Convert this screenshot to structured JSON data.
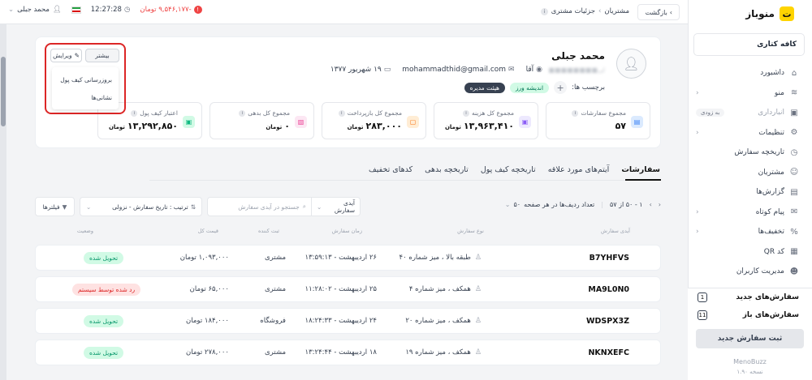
{
  "brand": {
    "name": "منوباز",
    "logo_glyph": "ت"
  },
  "sidebar": {
    "cafe": "کافه کتاری",
    "items": [
      {
        "label": "داشبورد",
        "icon": "dashboard-icon",
        "glyph": "⌂"
      },
      {
        "label": "منو",
        "icon": "layers-icon",
        "glyph": "≋",
        "chevron": true
      },
      {
        "label": "انبارداری",
        "icon": "warehouse-icon",
        "glyph": "▣",
        "soon": "به زودی",
        "muted": true
      },
      {
        "label": "تنظیمات",
        "icon": "gear-icon",
        "glyph": "⚙",
        "chevron": true
      },
      {
        "label": "تاریخچه سفارش",
        "icon": "history-icon",
        "glyph": "◷"
      },
      {
        "label": "مشتریان",
        "icon": "users-icon",
        "glyph": "☺"
      },
      {
        "label": "گزارش‌ها",
        "icon": "report-icon",
        "glyph": "▤"
      },
      {
        "label": "پیام کوتاه",
        "icon": "sms-icon",
        "glyph": "✉",
        "chevron": true
      },
      {
        "label": "تخفیف‌ها",
        "icon": "discount-icon",
        "glyph": "%",
        "chevron": true
      },
      {
        "label": "کد QR",
        "icon": "qr-icon",
        "glyph": "▦"
      },
      {
        "label": "مدیریت کاربران",
        "icon": "user-manage-icon",
        "glyph": "☻"
      }
    ],
    "counters": [
      {
        "label": "سفارش‌های جدید",
        "count": "1"
      },
      {
        "label": "سفارش‌های باز",
        "count": "11"
      }
    ],
    "new_order_button": "ثبت سفارش جدید",
    "footer_brand": "MenoBuzz",
    "footer_version": "نسخه ۱.۹۰"
  },
  "topbar": {
    "back": "بازگشت",
    "back_icon": "›",
    "crumb_parent": "مشتریان",
    "crumb_current": "جزئیات مشتری",
    "time": "12:27:28",
    "user": "محمد جبلی",
    "balance": "-۹,۵۴۶,۱۷۷ تومان",
    "flag_colors": [
      "#239f40",
      "#ffffff",
      "#da0000"
    ]
  },
  "customer": {
    "name": "محمد جبلی",
    "subline": "لی■■■■■■■■",
    "gender": "آقا",
    "email": "mohammadthid@gmail.com",
    "birthday": "۱۹ شهریور ۱۳۷۷",
    "tags_label": "برچسب ها:",
    "tags": [
      "اندیشه ورز",
      "هیئت مدیره"
    ],
    "edit_button": "ویرایش",
    "more_button": "بیشتر",
    "menu": [
      "بروزرسانی کیف پول",
      "نشانی‌ها"
    ],
    "stats": [
      {
        "label": "مجموع سفارشات",
        "value": "۵۷",
        "unit": "",
        "icon": "orders-icon",
        "color": "#3b82f6",
        "bg": "#dbeafe",
        "glyph": "▤"
      },
      {
        "label": "مجموع کل هزینه",
        "value": "۱۳,۹۶۳,۴۱۰",
        "unit": "تومان",
        "icon": "cost-icon",
        "color": "#8b5cf6",
        "bg": "#ede9fe",
        "glyph": "▣"
      },
      {
        "label": "مجموع کل بازپرداخت",
        "value": "۲۸۳,۰۰۰",
        "unit": "تومان",
        "icon": "refund-icon",
        "color": "#f97316",
        "bg": "#ffedd5",
        "glyph": "▢"
      },
      {
        "label": "مجموع کل بدهی",
        "value": "۰",
        "unit": "تومان",
        "icon": "debt-icon",
        "color": "#ec4899",
        "bg": "#fce7f3",
        "glyph": "▧"
      },
      {
        "label": "اعتبار کیف پول",
        "value": "۱۳,۲۹۲,۸۵۰",
        "unit": "تومان",
        "icon": "wallet-icon",
        "color": "#10b981",
        "bg": "#d1fae5",
        "glyph": "▣"
      }
    ]
  },
  "tabs": [
    "سفارشات",
    "آیتم‌های مورد علاقه",
    "تاریخچه کیف پول",
    "تاریخچه بدهی",
    "کدهای تخفیف"
  ],
  "toolbar": {
    "pager_range": "۱ - ۵۰ از ۵۷",
    "per_page_label": "تعداد ردیف‌ها در هر صفحه",
    "per_page_value": "۵۰",
    "filter_field": "آیدی سفارش",
    "search_placeholder": "جستجو در آیدی سفارش",
    "sort": "ترتیب : تاریخ سفارش - نزولی",
    "filters": "فیلترها"
  },
  "table": {
    "headers": [
      "آیدی سفارش",
      "نوع سفارش",
      "زمان سفارش",
      "ثبت کننده",
      "قیمت کل",
      "وضعیت"
    ],
    "rows": [
      {
        "id": "B7YHFVS",
        "type": "طبقه بالا ، میز شماره ۴۰",
        "time": "۲۶ اردیبهشت - ۱۳:۵۹:۱۳",
        "creator": "مشتری",
        "price": "۱,۰۹۳,۰۰۰ تومان",
        "status": "تحویل شده",
        "status_kind": "green"
      },
      {
        "id": "MA9L0N0",
        "type": "همکف ، میز شماره ۴",
        "time": "۲۵ اردیبهشت - ۱۱:۲۸:۰۲",
        "creator": "مشتری",
        "price": "۶۵,۰۰۰ تومان",
        "status": "رد شده توسط سیستم",
        "status_kind": "red"
      },
      {
        "id": "WDSPX3Z",
        "type": "همکف ، میز شماره ۲۰",
        "time": "۲۴ اردیبهشت - ۱۸:۲۴:۳۳",
        "creator": "فروشگاه",
        "price": "۱۸۴,۰۰۰ تومان",
        "status": "تحویل شده",
        "status_kind": "green"
      },
      {
        "id": "NKNXEFC",
        "type": "همکف ، میز شماره ۱۹",
        "time": "۱۸ اردیبهشت - ۱۳:۲۴:۴۴",
        "creator": "مشتری",
        "price": "۲۷۸,۰۰۰ تومان",
        "status": "تحویل شده",
        "status_kind": "green"
      }
    ]
  }
}
